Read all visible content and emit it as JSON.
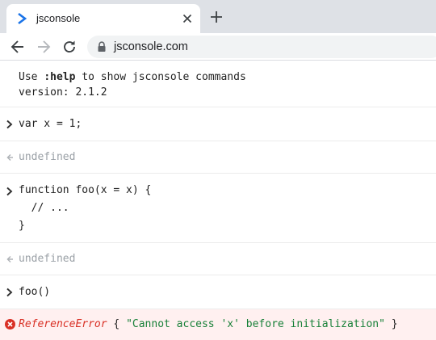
{
  "browser": {
    "tab": {
      "title": "jsconsole"
    },
    "address": {
      "url": "jsconsole.com"
    }
  },
  "console": {
    "intro": {
      "line1_prefix": "Use ",
      "line1_cmd": ":help",
      "line1_suffix": " to show jsconsole commands",
      "line2": "version: 2.1.2"
    },
    "entries": [
      {
        "kind": "input",
        "lines": [
          "var x = 1;"
        ]
      },
      {
        "kind": "output",
        "lines": [
          "undefined"
        ]
      },
      {
        "kind": "input",
        "lines": [
          "function foo(x = x) {",
          "  // ...",
          "}"
        ]
      },
      {
        "kind": "output",
        "lines": [
          "undefined"
        ]
      },
      {
        "kind": "input",
        "lines": [
          "foo()"
        ]
      }
    ],
    "error": {
      "name": "ReferenceError",
      "open": " { ",
      "message": "\"Cannot access 'x' before initialization\"",
      "close": " }"
    }
  },
  "colors": {
    "tabstrip": "#dee1e6",
    "error_bg": "#fff0f0",
    "error_red": "#d93025",
    "string_green": "#188038",
    "muted": "#9aa0a6"
  }
}
